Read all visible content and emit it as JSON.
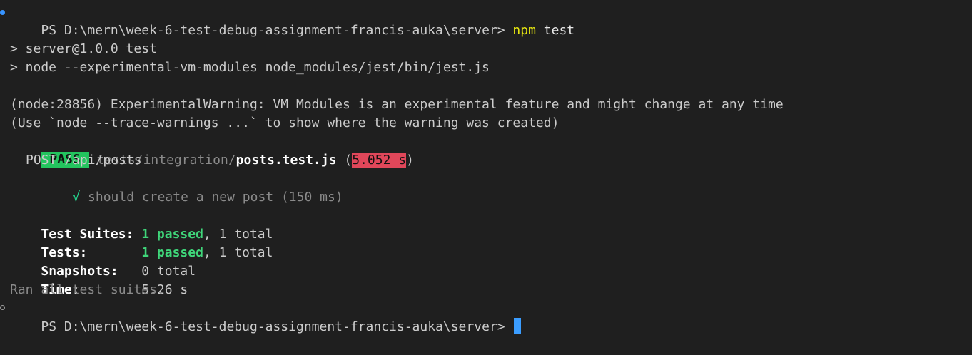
{
  "terminal": {
    "prompt1": {
      "ps": "PS D:\\mern\\week-6-test-debug-assignment-francis-auka\\server>",
      "command": "npm",
      "args": "test"
    },
    "script_line1": "> server@1.0.0 test",
    "script_line2": "> node --experimental-vm-modules node_modules/jest/bin/jest.js",
    "warning_line1": "(node:28856) ExperimentalWarning: VM Modules is an experimental feature and might change at any time",
    "warning_line2": "(Use `node --trace-warnings ...` to show where the warning was created)",
    "result": {
      "badge": "PASS",
      "path_dir": "tests/integration/",
      "path_file": "posts.test.js",
      "open_paren": "(",
      "duration": "5.052 s",
      "close_paren": ")"
    },
    "describe_block": "POST /api/posts",
    "test_case": {
      "check": "√",
      "name": "should create a new post (150 ms)"
    },
    "summary": {
      "suites_label": "Test Suites:",
      "suites_passed": "1 passed",
      "suites_total": ", 1 total",
      "tests_label": "Tests:",
      "tests_passed": "1 passed",
      "tests_total": ", 1 total",
      "snapshots_label": "Snapshots:",
      "snapshots_value": "0 total",
      "time_label": "Time:",
      "time_value": "5.26 s",
      "ran_all": "Ran all test suites."
    },
    "prompt2": {
      "ps": "PS D:\\mern\\week-6-test-debug-assignment-francis-auka\\server>"
    },
    "colors": {
      "background": "#1f1f1f",
      "pass_badge": "#23c45e",
      "time_badge": "#e0475a",
      "command": "#e5e510",
      "cursor": "#3b9dff"
    }
  }
}
